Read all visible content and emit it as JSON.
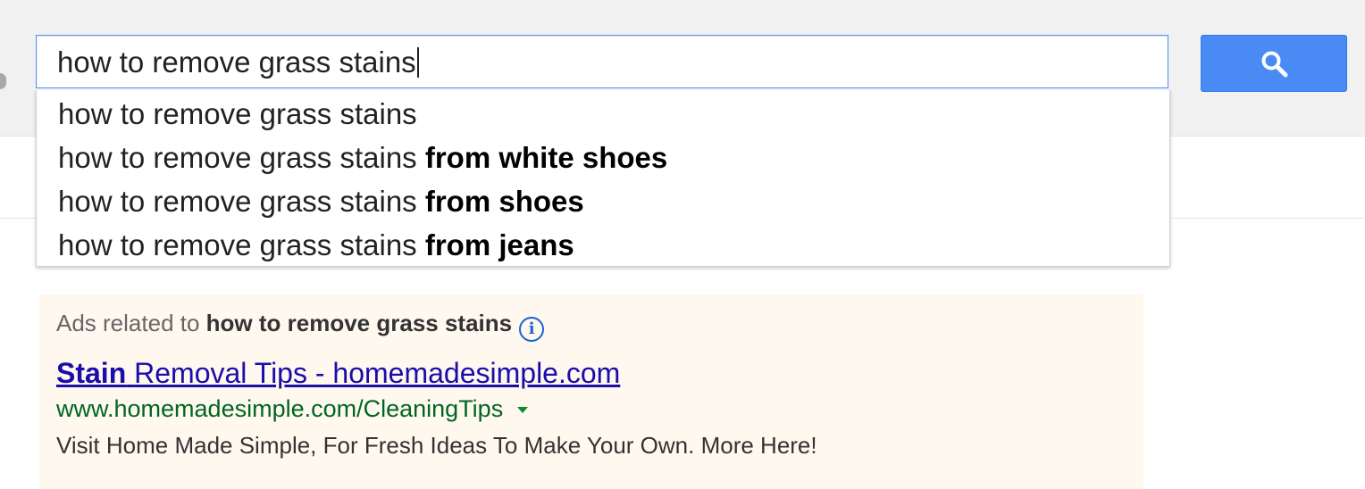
{
  "search": {
    "query": "how to remove grass stains",
    "button_icon": "search-icon"
  },
  "suggestions": [
    {
      "base": "how to remove grass stains",
      "completion": ""
    },
    {
      "base": "how to remove grass stains",
      "completion": "from white shoes"
    },
    {
      "base": "how to remove grass stains",
      "completion": "from shoes"
    },
    {
      "base": "how to remove grass stains",
      "completion": "from jeans"
    }
  ],
  "ads": {
    "header_prefix": "Ads related to",
    "header_query": "how to remove grass stains",
    "info_icon": "info-icon",
    "title_bold": "Stain",
    "title_rest": "Removal Tips - homemadesimple.com",
    "display_url": "www.homemadesimple.com/CleaningTips",
    "description": "Visit Home Made Simple, For Fresh Ideas To Make Your Own. More Here!"
  },
  "colors": {
    "accent_blue": "#4a8af4",
    "link": "#1a0dab",
    "url_green": "#006621",
    "ad_background": "#fff8ee"
  }
}
